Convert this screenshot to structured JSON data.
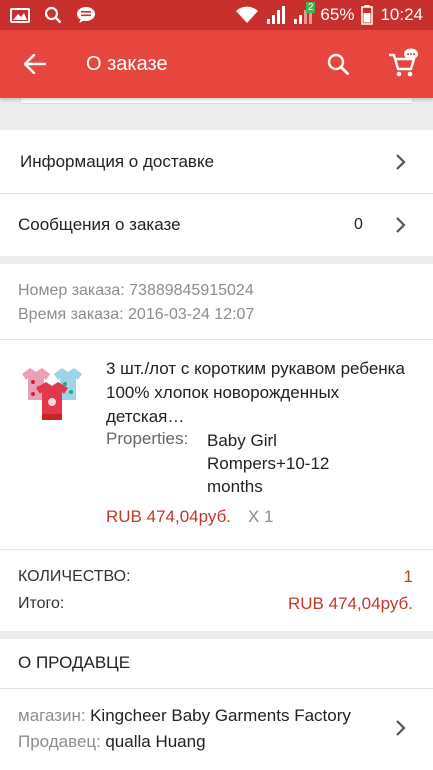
{
  "statusbar": {
    "battery": "65%",
    "time": "10:24",
    "sim_badge": "2",
    "icons": [
      "gallery-icon",
      "search-icon",
      "message-icon",
      "wifi-icon",
      "signal-icon",
      "signal-icon",
      "battery-icon"
    ]
  },
  "appbar": {
    "title": "О заказе",
    "icons": [
      "back-arrow-icon",
      "search-icon",
      "cart-icon"
    ]
  },
  "shipping": {
    "label": "Информация о доставке"
  },
  "messages": {
    "label": "Сообщения о заказе",
    "count": "0"
  },
  "order": {
    "number_label": "Номер заказа:",
    "number": "73889845915024",
    "time_label": "Время заказа:",
    "time": "2016-03-24 12:07"
  },
  "product": {
    "title": "3 шт./лот с коротким рукавом ребенка 100% хлопок новорожденных детская…",
    "properties_label": "Properties:",
    "properties_value": "Baby Girl Rompers+10-12 months",
    "price": "RUB 474,04руб.",
    "quantity": "X 1"
  },
  "summary": {
    "qty_label": "КОЛИЧЕСТВО:",
    "qty_value": "1",
    "total_label": "Итого:",
    "total_value": "RUB 474,04руб."
  },
  "seller": {
    "section_title": "О ПРОДАВЦЕ",
    "store_label": "магазин:",
    "store_value": "Kingcheer Baby Garments Factory",
    "seller_label": "Продавец:",
    "seller_value": "qualla Huang"
  },
  "colors": {
    "statusbar": "#c7302d",
    "appbar": "#e6463e",
    "price": "#c0392b",
    "background": "#ececec"
  }
}
